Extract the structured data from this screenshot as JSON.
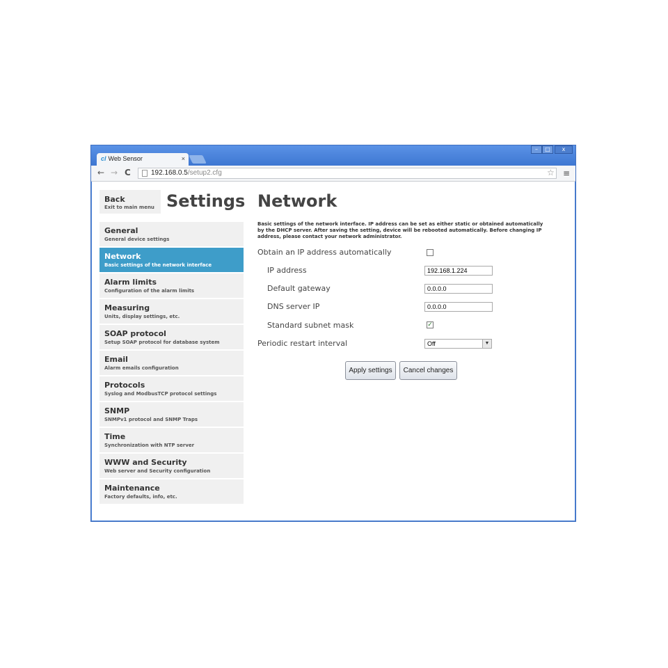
{
  "browser": {
    "tab_title": "Web Sensor",
    "tab_close": "×",
    "url_host": "192.168.0.5",
    "url_path": "/setup2.cfg",
    "window_controls": {
      "minimize": "–",
      "maximize": "□",
      "close": "x"
    },
    "icons": {
      "back": "←",
      "forward": "→",
      "reload": "C",
      "star": "☆",
      "menu": "≡"
    }
  },
  "sidebar": {
    "back": {
      "title": "Back",
      "subtitle": "Exit to main menu"
    },
    "heading": "Settings",
    "items": [
      {
        "title": "General",
        "subtitle": "General device settings"
      },
      {
        "title": "Network",
        "subtitle": "Basic settings of the network interface"
      },
      {
        "title": "Alarm limits",
        "subtitle": "Configuration of the alarm limits"
      },
      {
        "title": "Measuring",
        "subtitle": "Units, display settings, etc."
      },
      {
        "title": "SOAP protocol",
        "subtitle": "Setup SOAP protocol for database system"
      },
      {
        "title": "Email",
        "subtitle": "Alarm emails configuration"
      },
      {
        "title": "Protocols",
        "subtitle": "Syslog and ModbusTCP protocol settings"
      },
      {
        "title": "SNMP",
        "subtitle": "SNMPv1 protocol and SNMP Traps"
      },
      {
        "title": "Time",
        "subtitle": "Synchronization with NTP server"
      },
      {
        "title": "WWW and Security",
        "subtitle": "Web server and Security configuration"
      },
      {
        "title": "Maintenance",
        "subtitle": "Factory defaults, info, etc."
      }
    ]
  },
  "main": {
    "heading": "Network",
    "description": "Basic settings of the network interface. IP address can be set as either static or obtained automatically by the DHCP server. After saving the setting, device will be rebooted automatically. Before changing IP address, please contact your network administrator.",
    "fields": {
      "obtain_auto": {
        "label": "Obtain an IP address automatically",
        "checked": false,
        "mark": ""
      },
      "ip_address": {
        "label": "IP address",
        "value": "192.168.1.224"
      },
      "gateway": {
        "label": "Default gateway",
        "value": "0.0.0.0"
      },
      "dns": {
        "label": "DNS server IP",
        "value": "0.0.0.0"
      },
      "subnet": {
        "label": "Standard subnet mask",
        "checked": true,
        "mark": "✓"
      },
      "restart": {
        "label": "Periodic restart interval",
        "value": "Off",
        "arrow": "▼"
      }
    },
    "buttons": {
      "apply": "Apply settings",
      "cancel": "Cancel changes"
    }
  }
}
